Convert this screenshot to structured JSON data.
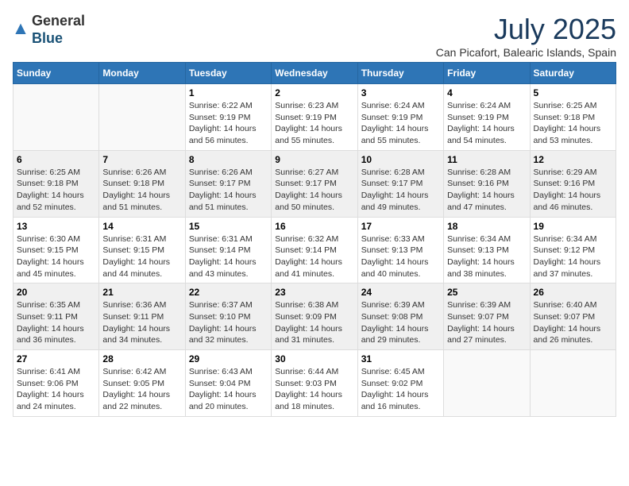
{
  "header": {
    "logo_general": "General",
    "logo_blue": "Blue",
    "month_year": "July 2025",
    "location": "Can Picafort, Balearic Islands, Spain"
  },
  "weekdays": [
    "Sunday",
    "Monday",
    "Tuesday",
    "Wednesday",
    "Thursday",
    "Friday",
    "Saturday"
  ],
  "weeks": [
    [
      {
        "day": "",
        "info": ""
      },
      {
        "day": "",
        "info": ""
      },
      {
        "day": "1",
        "info": "Sunrise: 6:22 AM\nSunset: 9:19 PM\nDaylight: 14 hours and 56 minutes."
      },
      {
        "day": "2",
        "info": "Sunrise: 6:23 AM\nSunset: 9:19 PM\nDaylight: 14 hours and 55 minutes."
      },
      {
        "day": "3",
        "info": "Sunrise: 6:24 AM\nSunset: 9:19 PM\nDaylight: 14 hours and 55 minutes."
      },
      {
        "day": "4",
        "info": "Sunrise: 6:24 AM\nSunset: 9:19 PM\nDaylight: 14 hours and 54 minutes."
      },
      {
        "day": "5",
        "info": "Sunrise: 6:25 AM\nSunset: 9:18 PM\nDaylight: 14 hours and 53 minutes."
      }
    ],
    [
      {
        "day": "6",
        "info": "Sunrise: 6:25 AM\nSunset: 9:18 PM\nDaylight: 14 hours and 52 minutes."
      },
      {
        "day": "7",
        "info": "Sunrise: 6:26 AM\nSunset: 9:18 PM\nDaylight: 14 hours and 51 minutes."
      },
      {
        "day": "8",
        "info": "Sunrise: 6:26 AM\nSunset: 9:17 PM\nDaylight: 14 hours and 51 minutes."
      },
      {
        "day": "9",
        "info": "Sunrise: 6:27 AM\nSunset: 9:17 PM\nDaylight: 14 hours and 50 minutes."
      },
      {
        "day": "10",
        "info": "Sunrise: 6:28 AM\nSunset: 9:17 PM\nDaylight: 14 hours and 49 minutes."
      },
      {
        "day": "11",
        "info": "Sunrise: 6:28 AM\nSunset: 9:16 PM\nDaylight: 14 hours and 47 minutes."
      },
      {
        "day": "12",
        "info": "Sunrise: 6:29 AM\nSunset: 9:16 PM\nDaylight: 14 hours and 46 minutes."
      }
    ],
    [
      {
        "day": "13",
        "info": "Sunrise: 6:30 AM\nSunset: 9:15 PM\nDaylight: 14 hours and 45 minutes."
      },
      {
        "day": "14",
        "info": "Sunrise: 6:31 AM\nSunset: 9:15 PM\nDaylight: 14 hours and 44 minutes."
      },
      {
        "day": "15",
        "info": "Sunrise: 6:31 AM\nSunset: 9:14 PM\nDaylight: 14 hours and 43 minutes."
      },
      {
        "day": "16",
        "info": "Sunrise: 6:32 AM\nSunset: 9:14 PM\nDaylight: 14 hours and 41 minutes."
      },
      {
        "day": "17",
        "info": "Sunrise: 6:33 AM\nSunset: 9:13 PM\nDaylight: 14 hours and 40 minutes."
      },
      {
        "day": "18",
        "info": "Sunrise: 6:34 AM\nSunset: 9:13 PM\nDaylight: 14 hours and 38 minutes."
      },
      {
        "day": "19",
        "info": "Sunrise: 6:34 AM\nSunset: 9:12 PM\nDaylight: 14 hours and 37 minutes."
      }
    ],
    [
      {
        "day": "20",
        "info": "Sunrise: 6:35 AM\nSunset: 9:11 PM\nDaylight: 14 hours and 36 minutes."
      },
      {
        "day": "21",
        "info": "Sunrise: 6:36 AM\nSunset: 9:11 PM\nDaylight: 14 hours and 34 minutes."
      },
      {
        "day": "22",
        "info": "Sunrise: 6:37 AM\nSunset: 9:10 PM\nDaylight: 14 hours and 32 minutes."
      },
      {
        "day": "23",
        "info": "Sunrise: 6:38 AM\nSunset: 9:09 PM\nDaylight: 14 hours and 31 minutes."
      },
      {
        "day": "24",
        "info": "Sunrise: 6:39 AM\nSunset: 9:08 PM\nDaylight: 14 hours and 29 minutes."
      },
      {
        "day": "25",
        "info": "Sunrise: 6:39 AM\nSunset: 9:07 PM\nDaylight: 14 hours and 27 minutes."
      },
      {
        "day": "26",
        "info": "Sunrise: 6:40 AM\nSunset: 9:07 PM\nDaylight: 14 hours and 26 minutes."
      }
    ],
    [
      {
        "day": "27",
        "info": "Sunrise: 6:41 AM\nSunset: 9:06 PM\nDaylight: 14 hours and 24 minutes."
      },
      {
        "day": "28",
        "info": "Sunrise: 6:42 AM\nSunset: 9:05 PM\nDaylight: 14 hours and 22 minutes."
      },
      {
        "day": "29",
        "info": "Sunrise: 6:43 AM\nSunset: 9:04 PM\nDaylight: 14 hours and 20 minutes."
      },
      {
        "day": "30",
        "info": "Sunrise: 6:44 AM\nSunset: 9:03 PM\nDaylight: 14 hours and 18 minutes."
      },
      {
        "day": "31",
        "info": "Sunrise: 6:45 AM\nSunset: 9:02 PM\nDaylight: 14 hours and 16 minutes."
      },
      {
        "day": "",
        "info": ""
      },
      {
        "day": "",
        "info": ""
      }
    ]
  ]
}
